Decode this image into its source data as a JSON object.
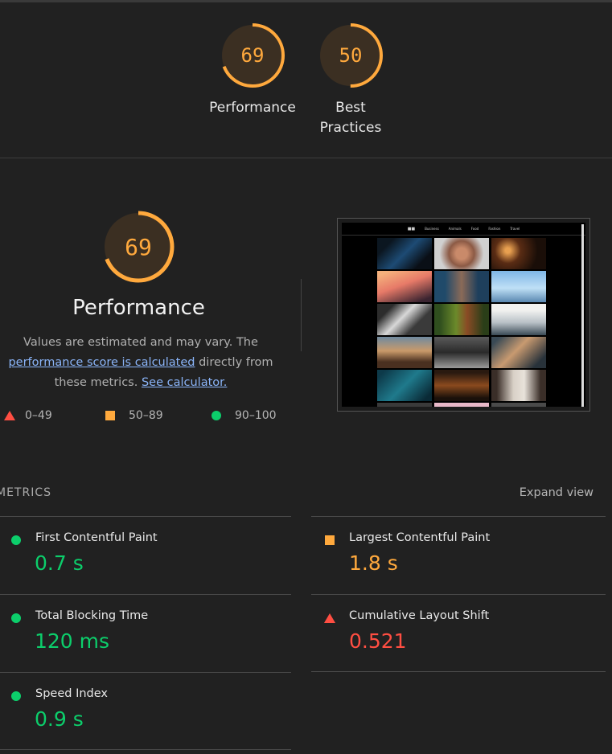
{
  "top_gauges": [
    {
      "score": "69",
      "label": "Performance",
      "value": 0.69
    },
    {
      "score": "50",
      "label_line1": "Best",
      "label_line2": "Practices",
      "value": 0.5
    }
  ],
  "main_gauge": {
    "score": "69",
    "value": 0.69
  },
  "performance_title": "Performance",
  "description": {
    "part1": "Values are estimated and may vary. The",
    "link1": "performance score is calculated",
    "part2": " directly from these metrics.",
    "link2": "See calculator."
  },
  "legend": [
    {
      "range": "0–49",
      "shape": "triangle",
      "color": "#ff4e42"
    },
    {
      "range": "50–89",
      "shape": "square",
      "color": "#ffa93d"
    },
    {
      "range": "90–100",
      "shape": "circle",
      "color": "#0cce6b"
    }
  ],
  "screenshot_nav": [
    "Business",
    "Animals",
    "Food",
    "Fashion",
    "Travel"
  ],
  "metrics_header": "METRICS",
  "expand_view": "Expand view",
  "metrics": [
    {
      "name": "First Contentful Paint",
      "value": "0.7 s",
      "status": "good"
    },
    {
      "name": "Largest Contentful Paint",
      "value": "1.8 s",
      "status": "average"
    },
    {
      "name": "Total Blocking Time",
      "value": "120 ms",
      "status": "good"
    },
    {
      "name": "Cumulative Layout Shift",
      "value": "0.521",
      "status": "poor"
    },
    {
      "name": "Speed Index",
      "value": "0.9 s",
      "status": "good"
    }
  ],
  "colors": {
    "good": "#0cce6b",
    "average": "#ffa93d",
    "poor": "#ff4e42",
    "background": "#212121"
  }
}
